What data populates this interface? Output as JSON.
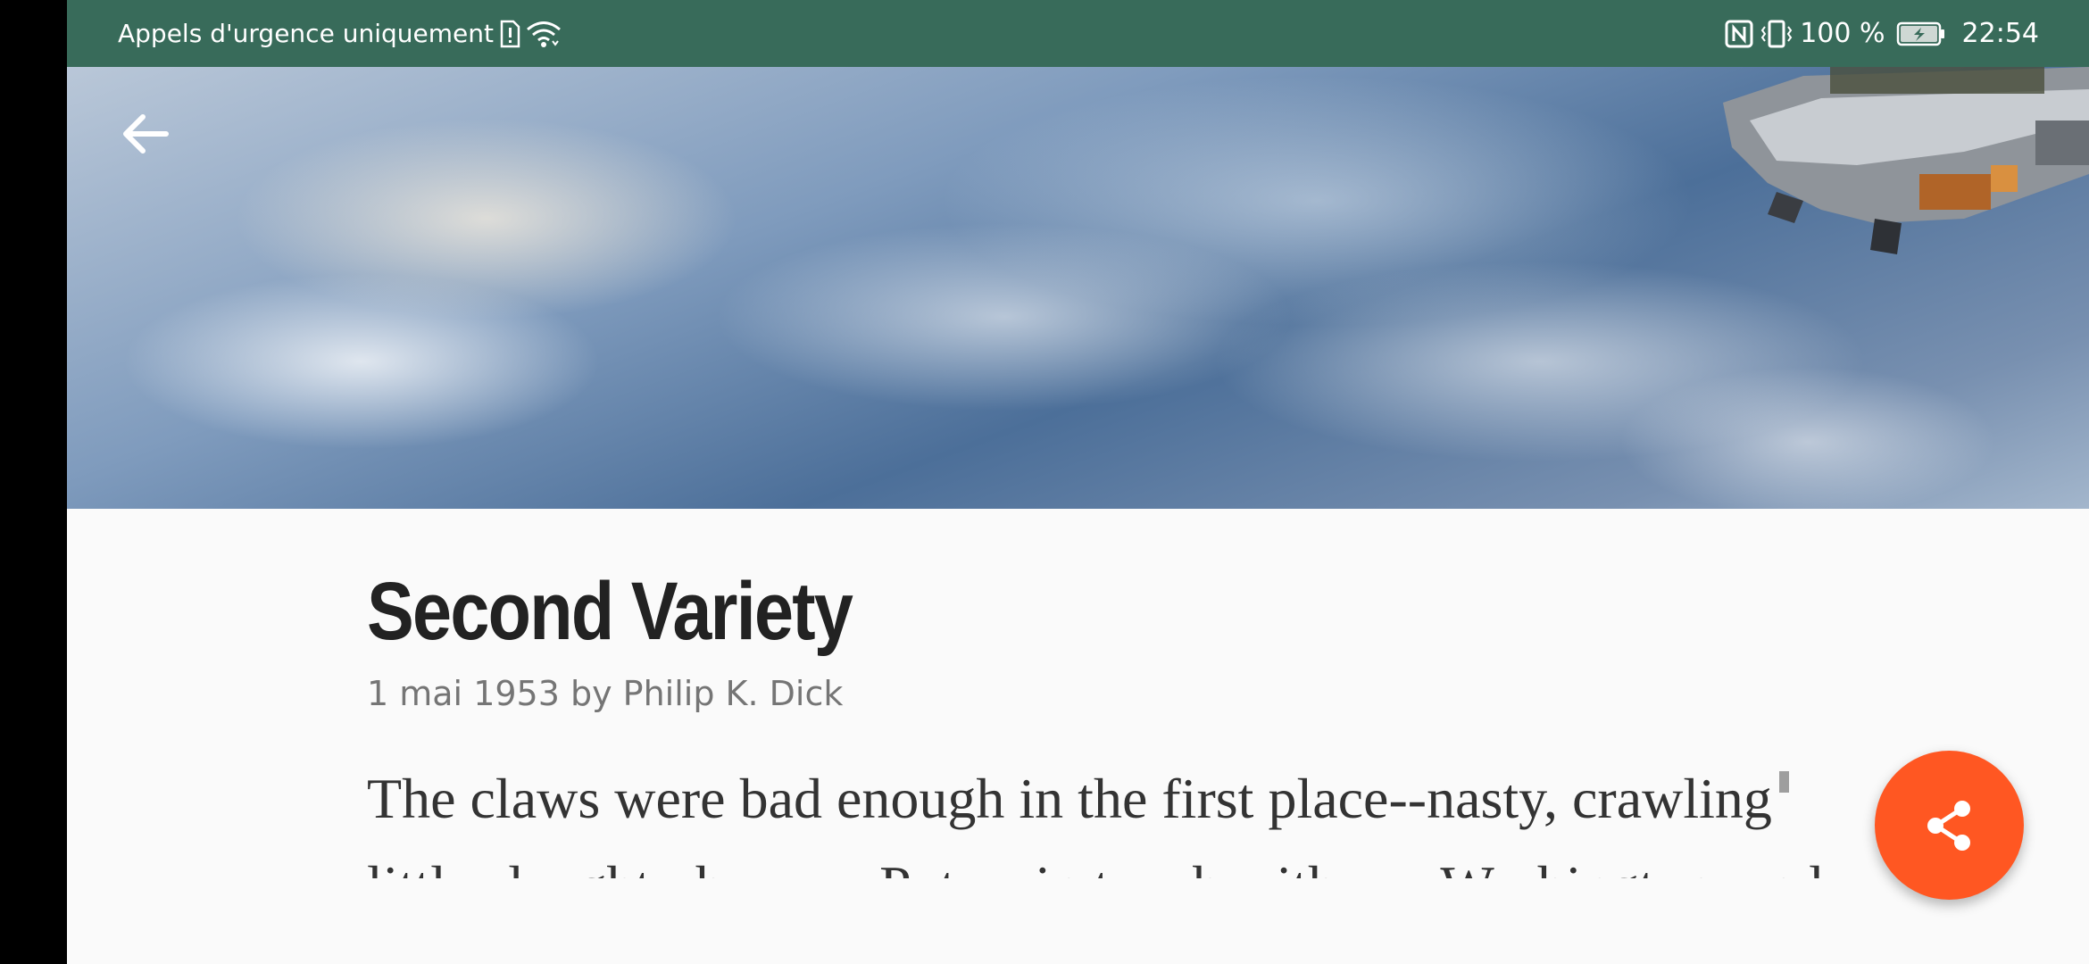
{
  "status_bar": {
    "carrier_text": "Appels d'urgence uniquement",
    "battery_percent": "100 %",
    "time": "22:54",
    "background_color": "#386b5a",
    "icons": [
      "alert-sim-icon",
      "wifi-icon",
      "nfc-icon",
      "vibrate-icon",
      "battery-charging-icon"
    ]
  },
  "header": {
    "image_description": "earth-from-space-photo",
    "back_icon": "arrow-back-icon"
  },
  "article": {
    "title": "Second Variety",
    "byline": "1 mai 1953 by Philip K. Dick",
    "paragraph_first": "The claws were bad enough in the first place--nasty, crawling",
    "paragraph_next": "little slaughterhouses. Put us in touch with our Washington, and tell"
  },
  "fab": {
    "icon": "share-icon",
    "color": "#ff5722"
  }
}
